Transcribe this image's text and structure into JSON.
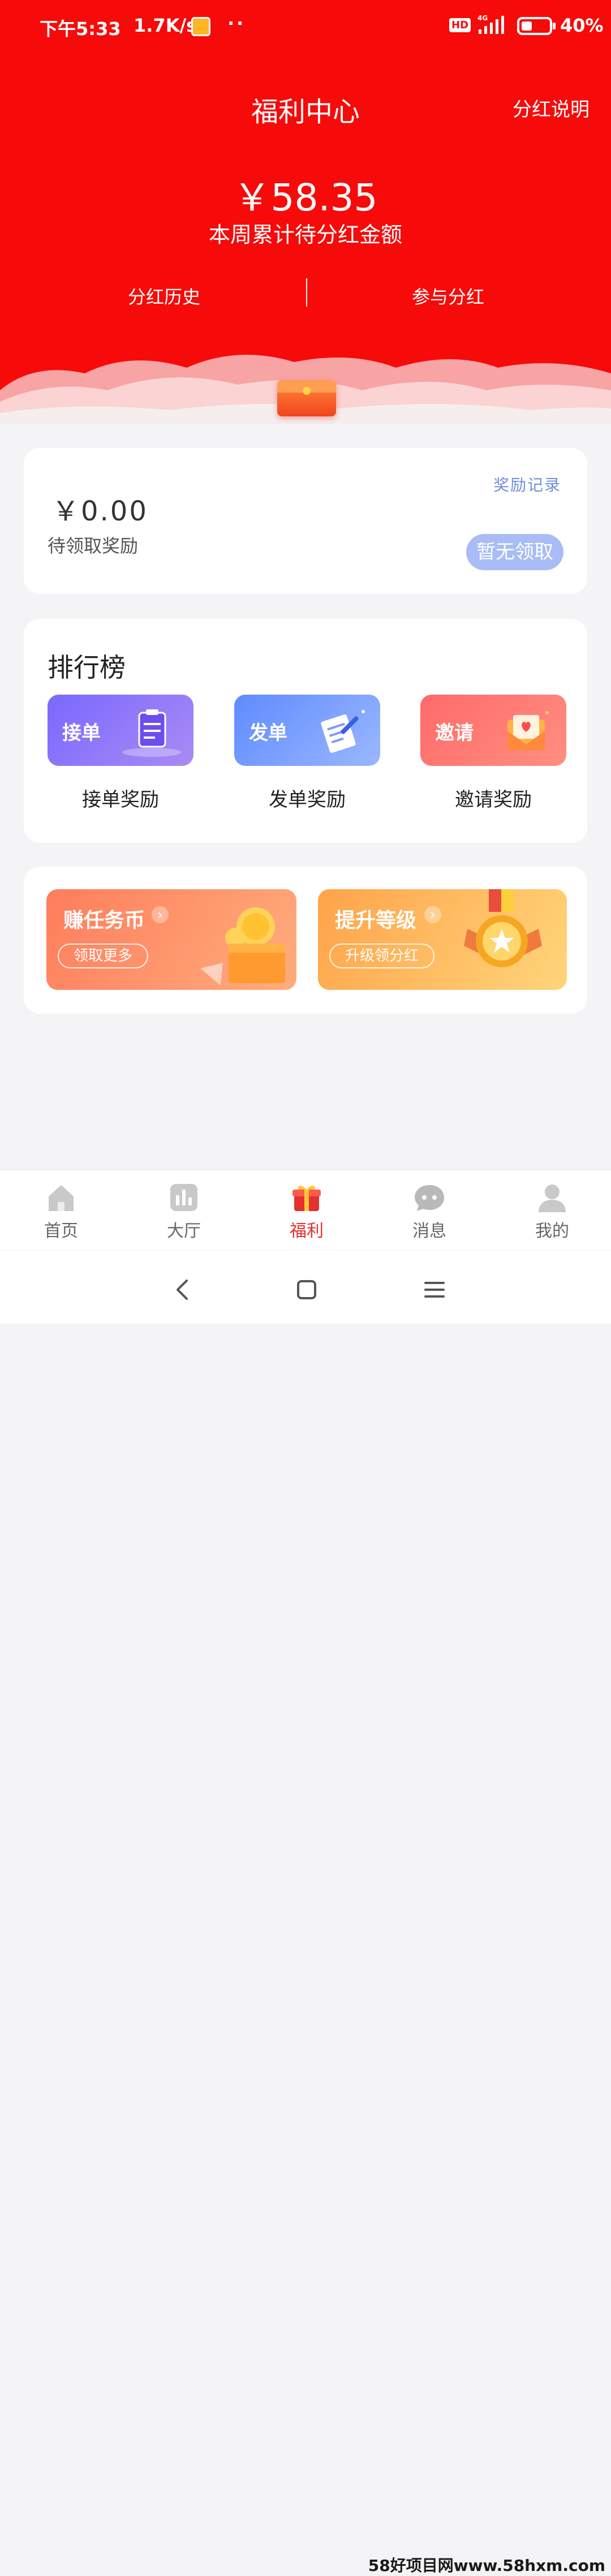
{
  "status_bar": {
    "time": "下午5:33",
    "speed": "1.7K/s",
    "dots": "··",
    "hd": "HD",
    "network": "4G",
    "battery": "40%"
  },
  "header": {
    "title": "福利中心",
    "explain_link": "分红说明",
    "amount": "￥58.35",
    "amount_label": "本周累计待分红金额",
    "history_link": "分红历史",
    "join_link": "参与分红"
  },
  "reward": {
    "amount": "￥0.00",
    "label": "待领取奖励",
    "record_link": "奖励记录",
    "claim_button": "暂无领取"
  },
  "ranking": {
    "title": "排行榜",
    "items": [
      {
        "tile_text": "接单",
        "label": "接单奖励",
        "icon": "clipboard-icon"
      },
      {
        "tile_text": "发单",
        "label": "发单奖励",
        "icon": "document-pen-icon"
      },
      {
        "tile_text": "邀请",
        "label": "邀请奖励",
        "icon": "heart-envelope-icon"
      }
    ]
  },
  "promos": [
    {
      "title": "赚任务币",
      "chevron": "›",
      "sub": "领取更多",
      "icon": "coin-box-icon"
    },
    {
      "title": "提升等级",
      "chevron": "›",
      "sub": "升级领分红",
      "icon": "medal-icon"
    }
  ],
  "bottom_nav": {
    "items": [
      {
        "label": "首页",
        "icon": "home-icon",
        "active": false
      },
      {
        "label": "大厅",
        "icon": "chart-icon",
        "active": false
      },
      {
        "label": "福利",
        "icon": "gift-icon",
        "active": true
      },
      {
        "label": "消息",
        "icon": "chat-icon",
        "active": false
      },
      {
        "label": "我的",
        "icon": "user-icon",
        "active": false
      }
    ]
  },
  "system_nav": {
    "back": "back-icon",
    "home": "home-square-icon",
    "menu": "menu-icon"
  },
  "watermark": "58好项目网www.58hxm.com",
  "colors": {
    "header_red": "#f70a0a",
    "active_nav": "#e5302e",
    "claim_button": "#a9bcf5",
    "record_link": "#6f8fd8"
  }
}
